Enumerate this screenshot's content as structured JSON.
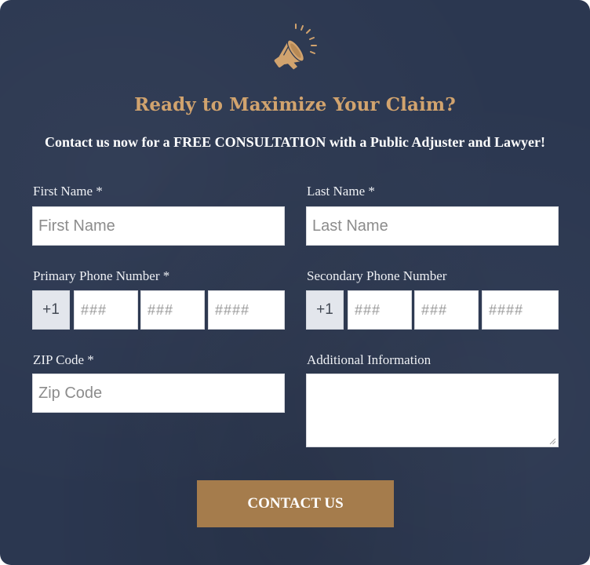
{
  "header": {
    "icon": "megaphone-icon",
    "title": "Ready to Maximize Your Claim?",
    "subtitle": "Contact us now for a FREE CONSULTATION with a Public Adjuster and Lawyer!"
  },
  "form": {
    "first_name": {
      "label": "First Name *",
      "placeholder": "First Name"
    },
    "last_name": {
      "label": "Last Name *",
      "placeholder": "Last Name"
    },
    "primary_phone": {
      "label": "Primary Phone Number *",
      "country_code": "+1",
      "area_placeholder": "###",
      "prefix_placeholder": "###",
      "line_placeholder": "####"
    },
    "secondary_phone": {
      "label": "Secondary Phone Number",
      "country_code": "+1",
      "area_placeholder": "###",
      "prefix_placeholder": "###",
      "line_placeholder": "####"
    },
    "zip": {
      "label": "ZIP Code *",
      "placeholder": "Zip Code"
    },
    "additional_info": {
      "label": "Additional Information",
      "value": ""
    },
    "submit_label": "CONTACT US"
  },
  "colors": {
    "background": "#2b3750",
    "accent_gold": "#d1a36e",
    "button": "#a57c4c"
  }
}
